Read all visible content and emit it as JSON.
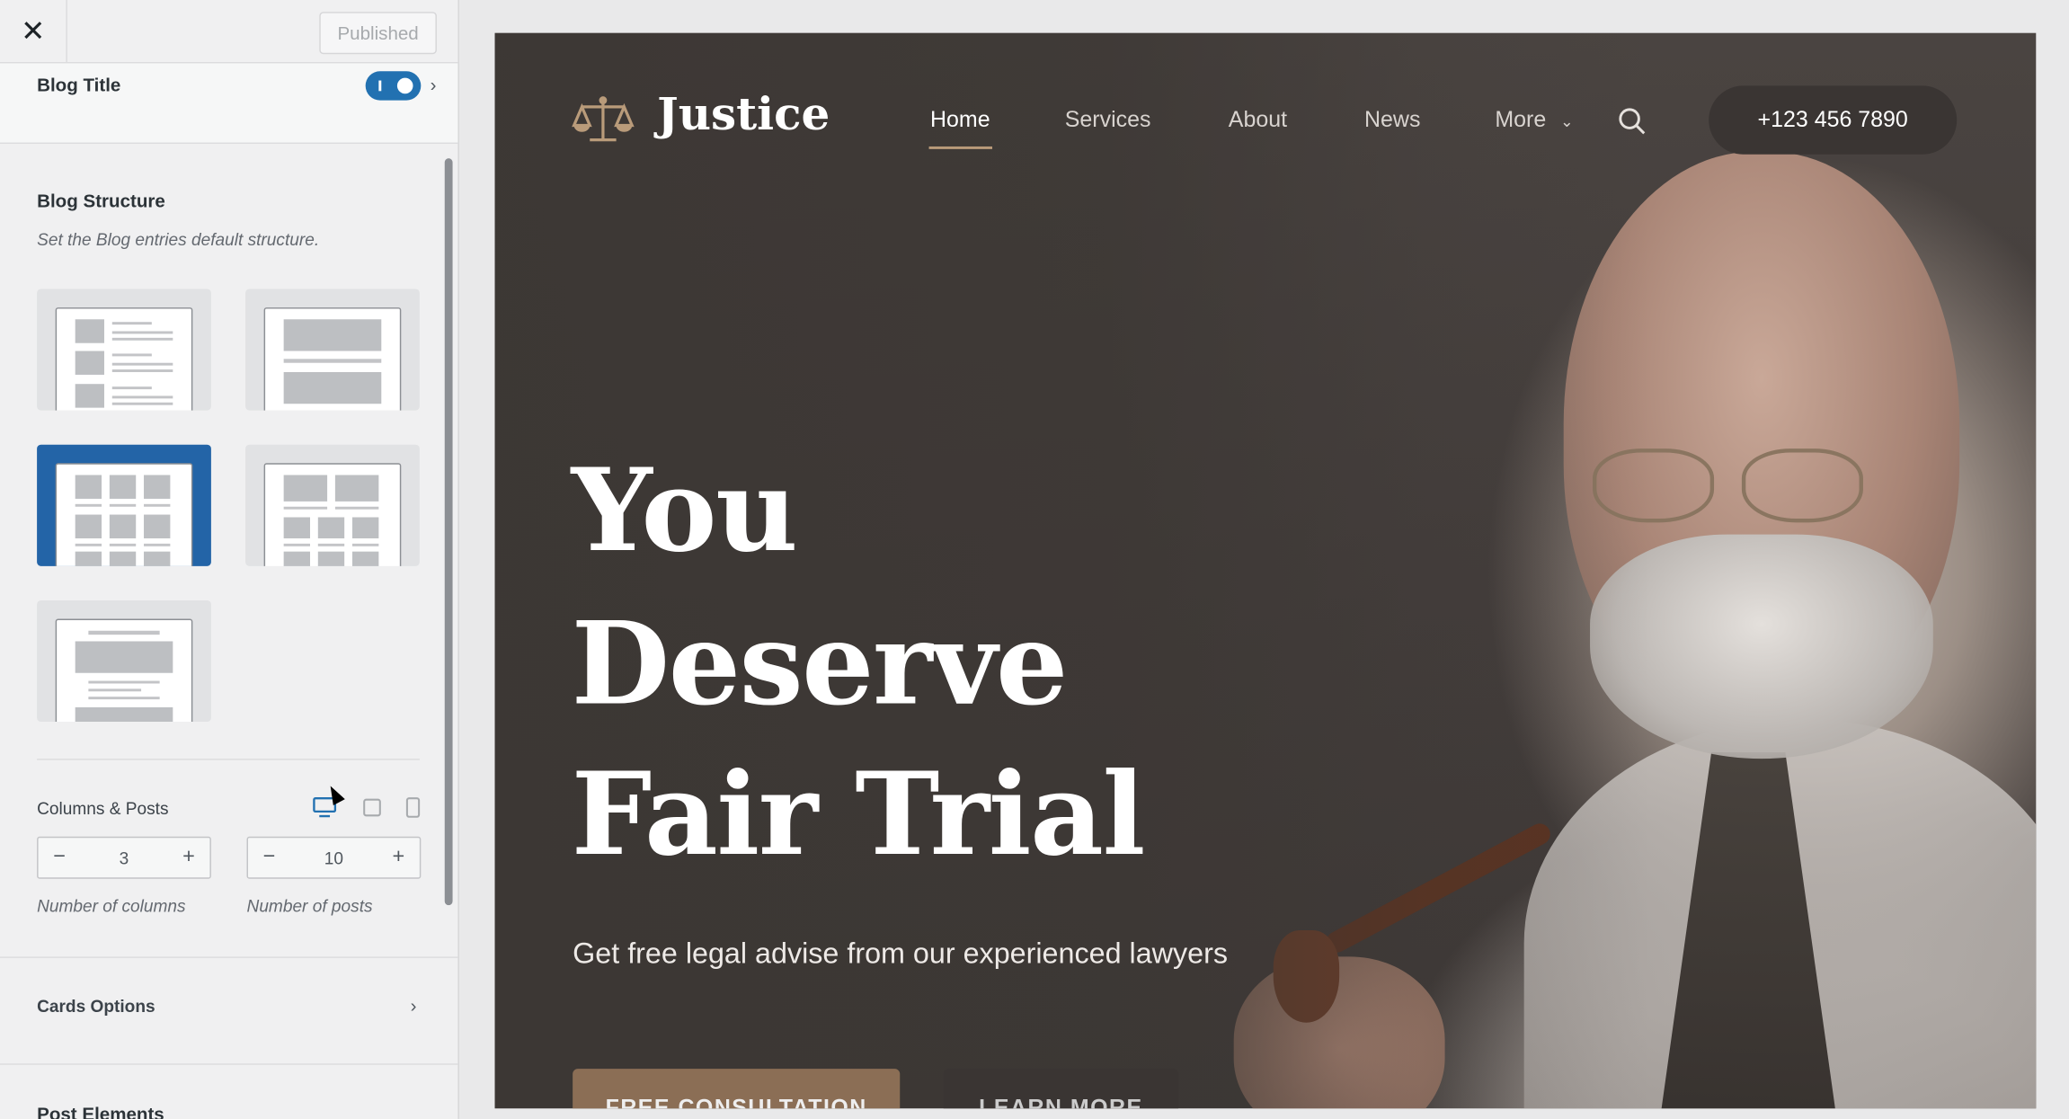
{
  "topbar": {
    "close_icon": "close-icon",
    "published_label": "Published"
  },
  "blog_title": {
    "label": "Blog Title",
    "enabled": true
  },
  "blog_structure": {
    "title": "Blog Structure",
    "description": "Set the Blog entries default structure.",
    "options": [
      "list-left-thumb",
      "stacked-large",
      "grid-3-columns",
      "grid-2-columns",
      "single-large"
    ],
    "selected": "grid-3-columns"
  },
  "columns_posts": {
    "title": "Columns & Posts",
    "devices": [
      "desktop-icon",
      "tablet-icon",
      "mobile-icon"
    ],
    "active_device": "desktop",
    "columns": "3",
    "posts": "10",
    "columns_label": "Number of columns",
    "posts_label": "Number of posts"
  },
  "cards_options": {
    "label": "Cards Options"
  },
  "post_elements": {
    "label": "Post Elements"
  },
  "preview": {
    "logo": "Justice",
    "nav": [
      "Home",
      "Services",
      "About",
      "News",
      "More"
    ],
    "active_nav": "Home",
    "phone": "+123 456 7890",
    "hero_lines": [
      "You",
      "Deserve",
      "Fair Trial"
    ],
    "subtitle": "Get free legal advise from our experienced lawyers",
    "cta_primary": "FREE CONSULTATION",
    "cta_secondary": "LEARN MORE"
  },
  "colors": {
    "accent": "#2271b1",
    "selected": "#2364a7",
    "brand_gold": "#b99b7a"
  }
}
